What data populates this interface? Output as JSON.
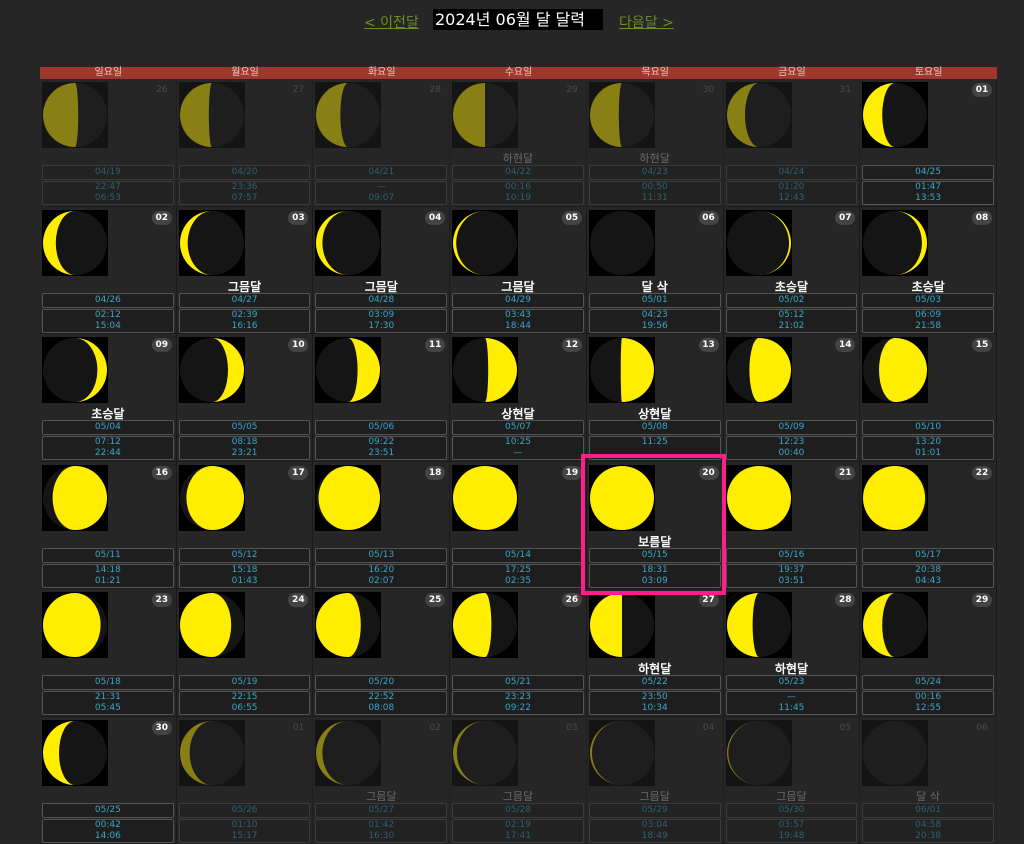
{
  "nav": {
    "prev": "< 이전달",
    "title": "2024년 06월 달 달력",
    "next": "다음달 >"
  },
  "weekdays": [
    "일요일",
    "월요일",
    "화요일",
    "수요일",
    "목요일",
    "금요일",
    "토요일"
  ],
  "colors": {
    "header": "#a0372c",
    "moon": "#ffee00",
    "text_accent": "#3aa6c8",
    "highlight": "#ff1f8a"
  },
  "days": [
    {
      "day": "26",
      "dim": true,
      "lunar": "04/19",
      "rise": "22:47",
      "set": "06:53",
      "phase": "",
      "illum": 0.55,
      "lit": "left"
    },
    {
      "day": "27",
      "dim": true,
      "lunar": "04/20",
      "rise": "23:36",
      "set": "07:57",
      "phase": "",
      "illum": 0.45,
      "lit": "left"
    },
    {
      "day": "28",
      "dim": true,
      "lunar": "04/21",
      "rise": "—",
      "set": "09:07",
      "phase": "",
      "illum": 0.38,
      "lit": "left"
    },
    {
      "day": "29",
      "dim": true,
      "lunar": "04/22",
      "rise": "00:16",
      "set": "10:19",
      "phase": "하현달",
      "illum": 0.5,
      "lit": "left"
    },
    {
      "day": "30",
      "dim": true,
      "lunar": "04/23",
      "rise": "00:50",
      "set": "11:31",
      "phase": "하현달",
      "illum": 0.45,
      "lit": "left"
    },
    {
      "day": "31",
      "dim": true,
      "lunar": "04/24",
      "rise": "01:20",
      "set": "12:43",
      "phase": "",
      "illum": 0.28,
      "lit": "left"
    },
    {
      "day": "01",
      "dim": false,
      "lunar": "04/25",
      "rise": "01:47",
      "set": "13:53",
      "phase": "",
      "illum": 0.3,
      "lit": "left"
    },
    {
      "day": "02",
      "dim": false,
      "lunar": "04/26",
      "rise": "02:12",
      "set": "15:04",
      "phase": "",
      "illum": 0.2,
      "lit": "left"
    },
    {
      "day": "03",
      "dim": false,
      "lunar": "04/27",
      "rise": "02:39",
      "set": "16:16",
      "phase": "그믐달",
      "illum": 0.12,
      "lit": "left"
    },
    {
      "day": "04",
      "dim": false,
      "lunar": "04/28",
      "rise": "03:09",
      "set": "17:30",
      "phase": "그믐달",
      "illum": 0.1,
      "lit": "left"
    },
    {
      "day": "05",
      "dim": false,
      "lunar": "04/29",
      "rise": "03:43",
      "set": "18:44",
      "phase": "그믐달",
      "illum": 0.05,
      "lit": "left"
    },
    {
      "day": "06",
      "dim": false,
      "lunar": "05/01",
      "rise": "04:23",
      "set": "19:56",
      "phase": "달 삭",
      "illum": 0.0,
      "lit": "right"
    },
    {
      "day": "07",
      "dim": false,
      "lunar": "05/02",
      "rise": "05:12",
      "set": "21:02",
      "phase": "초승달",
      "illum": 0.03,
      "lit": "right"
    },
    {
      "day": "08",
      "dim": false,
      "lunar": "05/03",
      "rise": "06:09",
      "set": "21:58",
      "phase": "초승달",
      "illum": 0.08,
      "lit": "right"
    },
    {
      "day": "09",
      "dim": false,
      "lunar": "05/04",
      "rise": "07:12",
      "set": "22:44",
      "phase": "초승달",
      "illum": 0.15,
      "lit": "right"
    },
    {
      "day": "10",
      "dim": false,
      "lunar": "05/05",
      "rise": "08:18",
      "set": "23:21",
      "phase": "",
      "illum": 0.25,
      "lit": "right"
    },
    {
      "day": "11",
      "dim": false,
      "lunar": "05/06",
      "rise": "09:22",
      "set": "23:51",
      "phase": "",
      "illum": 0.35,
      "lit": "right"
    },
    {
      "day": "12",
      "dim": false,
      "lunar": "05/07",
      "rise": "10:25",
      "set": "—",
      "phase": "상현달",
      "illum": 0.45,
      "lit": "right"
    },
    {
      "day": "13",
      "dim": false,
      "lunar": "05/08",
      "rise": "11:25",
      "set": "",
      "phase": "상현달",
      "illum": 0.52,
      "lit": "right"
    },
    {
      "day": "14",
      "dim": false,
      "lunar": "05/09",
      "rise": "12:23",
      "set": "00:40",
      "phase": "",
      "illum": 0.65,
      "lit": "right"
    },
    {
      "day": "15",
      "dim": false,
      "lunar": "05/10",
      "rise": "13:20",
      "set": "01:01",
      "phase": "",
      "illum": 0.75,
      "lit": "right"
    },
    {
      "day": "16",
      "dim": false,
      "lunar": "05/11",
      "rise": "14:18",
      "set": "01:21",
      "phase": "",
      "illum": 0.85,
      "lit": "right"
    },
    {
      "day": "17",
      "dim": false,
      "lunar": "05/12",
      "rise": "15:18",
      "set": "01:43",
      "phase": "",
      "illum": 0.9,
      "lit": "right"
    },
    {
      "day": "18",
      "dim": false,
      "lunar": "05/13",
      "rise": "16:20",
      "set": "02:07",
      "phase": "",
      "illum": 0.96,
      "lit": "right"
    },
    {
      "day": "19",
      "dim": false,
      "lunar": "05/14",
      "rise": "17:25",
      "set": "02:35",
      "phase": "",
      "illum": 1.0,
      "lit": "right"
    },
    {
      "day": "20",
      "dim": false,
      "lunar": "05/15",
      "rise": "18:31",
      "set": "03:09",
      "phase": "보름달",
      "illum": 1.0,
      "lit": "right"
    },
    {
      "day": "21",
      "dim": false,
      "lunar": "05/16",
      "rise": "19:37",
      "set": "03:51",
      "phase": "",
      "illum": 1.0,
      "lit": "right"
    },
    {
      "day": "22",
      "dim": false,
      "lunar": "05/17",
      "rise": "20:38",
      "set": "04:43",
      "phase": "",
      "illum": 0.97,
      "lit": "left"
    },
    {
      "day": "23",
      "dim": false,
      "lunar": "05/18",
      "rise": "21:31",
      "set": "05:45",
      "phase": "",
      "illum": 0.9,
      "lit": "left"
    },
    {
      "day": "24",
      "dim": false,
      "lunar": "05/19",
      "rise": "22:15",
      "set": "06:55",
      "phase": "",
      "illum": 0.8,
      "lit": "left"
    },
    {
      "day": "25",
      "dim": false,
      "lunar": "05/20",
      "rise": "22:52",
      "set": "08:08",
      "phase": "",
      "illum": 0.7,
      "lit": "left"
    },
    {
      "day": "26",
      "dim": false,
      "lunar": "05/21",
      "rise": "23:23",
      "set": "09:22",
      "phase": "",
      "illum": 0.6,
      "lit": "left"
    },
    {
      "day": "27",
      "dim": false,
      "lunar": "05/22",
      "rise": "23:50",
      "set": "10:34",
      "phase": "하현달",
      "illum": 0.5,
      "lit": "left"
    },
    {
      "day": "28",
      "dim": false,
      "lunar": "05/23",
      "rise": "—",
      "set": "11:45",
      "phase": "하현달",
      "illum": 0.4,
      "lit": "left"
    },
    {
      "day": "29",
      "dim": false,
      "lunar": "05/24",
      "rise": "00:16",
      "set": "12:55",
      "phase": "",
      "illum": 0.3,
      "lit": "left"
    },
    {
      "day": "30",
      "dim": false,
      "lunar": "05/25",
      "rise": "00:42",
      "set": "14:06",
      "phase": "",
      "illum": 0.25,
      "lit": "left"
    },
    {
      "day": "01",
      "dim": true,
      "lunar": "05/26",
      "rise": "01:10",
      "set": "15:17",
      "phase": "",
      "illum": 0.15,
      "lit": "left"
    },
    {
      "day": "02",
      "dim": true,
      "lunar": "05/27",
      "rise": "01:42",
      "set": "16:30",
      "phase": "그믐달",
      "illum": 0.1,
      "lit": "left"
    },
    {
      "day": "03",
      "dim": true,
      "lunar": "05/28",
      "rise": "02:19",
      "set": "17:41",
      "phase": "그믐달",
      "illum": 0.06,
      "lit": "left"
    },
    {
      "day": "04",
      "dim": true,
      "lunar": "05/29",
      "rise": "03:04",
      "set": "18:49",
      "phase": "그믐달",
      "illum": 0.03,
      "lit": "left"
    },
    {
      "day": "05",
      "dim": true,
      "lunar": "05/30",
      "rise": "03:57",
      "set": "19:48",
      "phase": "그믐달",
      "illum": 0.02,
      "lit": "left"
    },
    {
      "day": "06",
      "dim": true,
      "lunar": "06/01",
      "rise": "04:58",
      "set": "20:38",
      "phase": "달 삭",
      "illum": 0.0,
      "lit": "right"
    }
  ]
}
